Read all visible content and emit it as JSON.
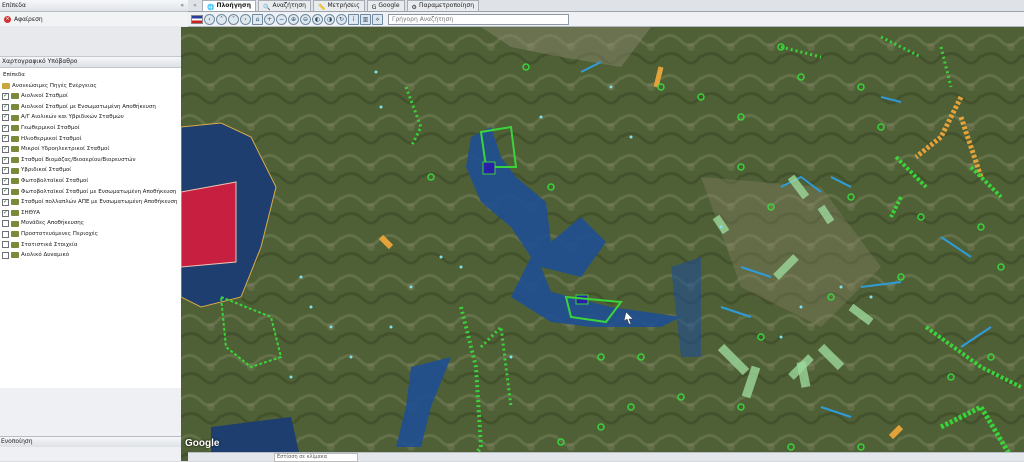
{
  "window": {
    "left_panel_header": "Επίπεδα",
    "remove_label": "Αφαίρεση",
    "bottom_header": "Ενοποίηση"
  },
  "tree": {
    "section_title": "Χαρτογραφικό Υπόβαθρο",
    "root": "Επίπεδα",
    "group": "Ανανεώσιμες Πηγές Ενέργειας",
    "layers": [
      {
        "label": "Αιολικοί Σταθμοί",
        "checked": true
      },
      {
        "label": "Αιολικοί Σταθμοί με Ενσωματωμένη Αποθήκευση",
        "checked": true
      },
      {
        "label": "Α/Γ Αιολικών και Υβριδικών Σταθμών",
        "checked": true
      },
      {
        "label": "Γεωθερμικοί Σταθμοί",
        "checked": true
      },
      {
        "label": "Ηλιοθερμικοί Σταθμοί",
        "checked": true
      },
      {
        "label": "Μικροί Υδροηλεκτρικοί Σταθμοί",
        "checked": true
      },
      {
        "label": "Σταθμοί Βιομάζας/Βιοαερίου/Βιορευστών",
        "checked": true
      },
      {
        "label": "Υβριδικοί Σταθμοί",
        "checked": true
      },
      {
        "label": "Φωτοβολταϊκοί Σταθμοί",
        "checked": true
      },
      {
        "label": "Φωτοβολταϊκοί Σταθμοί με Ενσωματωμένη Αποθήκευση",
        "checked": true
      }
    ],
    "extra": [
      {
        "label": "Σταθμοί πολλαπλών ΑΠΕ με Ενσωματωμένη Αποθήκευση",
        "checked": true
      },
      {
        "label": "ΣΗΘΥΑ",
        "checked": true
      },
      {
        "label": "Μονάδες Αποθήκευσης",
        "checked": false
      },
      {
        "label": "Προστατευόμενες Περιοχές",
        "checked": false
      },
      {
        "label": "Στατιστικά Στοιχεία",
        "checked": false
      },
      {
        "label": "Αιολικό Δυναμικό",
        "checked": false
      }
    ]
  },
  "tabs": [
    {
      "label": "Πλοήγηση",
      "icon": "globe-icon",
      "active": true
    },
    {
      "label": "Αναζήτηση",
      "icon": "search-icon",
      "active": false
    },
    {
      "label": "Μετρήσεις",
      "icon": "ruler-icon",
      "active": false
    },
    {
      "label": "Google",
      "icon": "google-icon",
      "active": false
    },
    {
      "label": "Παραμετροποίηση",
      "icon": "settings-icon",
      "active": false
    }
  ],
  "toolbar": {
    "quick_search_placeholder": "Γρήγορη Αναζήτηση"
  },
  "map": {
    "attribution": "Google",
    "status_text": "Εστίαση σε κλίμακα"
  },
  "colors": {
    "water": "#1f4f93",
    "lake_fill": "#c61f3f",
    "pv": "#3bd33b",
    "wind": "#5fd06a",
    "hydro": "#2f9bd9",
    "bio": "#e4a23a"
  }
}
